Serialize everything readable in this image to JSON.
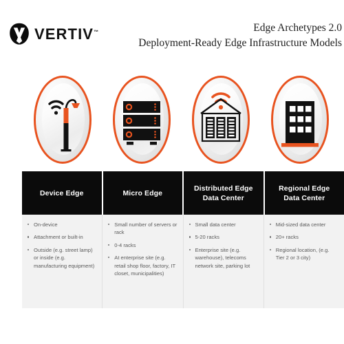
{
  "brand": {
    "logo_icon": "vertiv-logo-mark",
    "wordmark": "VERTIV",
    "trademark": "™",
    "accent_color": "#E8531F",
    "header_bg_color": "#0b0b0b",
    "body_bg_color": "#f2f2f2"
  },
  "title": {
    "line1": "Edge Archetypes 2.0",
    "line2": "Deployment-Ready Edge Infrastructure Models"
  },
  "columns": [
    {
      "icon_name": "street-lamp-wifi-icon",
      "header_line1": "Device Edge",
      "header_line2": "",
      "bullets": [
        "On-device",
        "Attachment or built-in",
        "Outside (e.g. street lamp) or inside (e.g. manufacturing equipment)"
      ]
    },
    {
      "icon_name": "server-stack-icon",
      "header_line1": "Micro Edge",
      "header_line2": "",
      "bullets": [
        "Small number of servers or rack",
        "0-4 racks",
        "At enterprise site (e.g. retail shop floor, factory, IT closet, municipalities)"
      ]
    },
    {
      "icon_name": "house-racks-wifi-icon",
      "header_line1": "Distributed Edge",
      "header_line2": "Data Center",
      "bullets": [
        "Small data center",
        "5-20 racks",
        "Enterprise site (e.g. warehouse), telecoms network site, parking lot"
      ]
    },
    {
      "icon_name": "office-building-icon",
      "header_line1": "Regional Edge",
      "header_line2": "Data Center",
      "bullets": [
        "Mid-sized data center",
        "20+ racks",
        "Regional location, (e.g. Tier 2 or 3 city)"
      ]
    }
  ]
}
